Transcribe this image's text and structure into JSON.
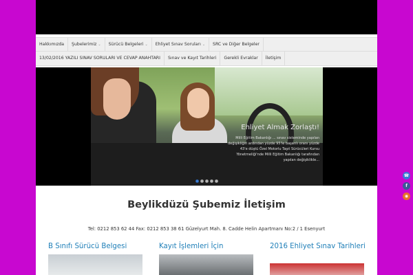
{
  "colors": {
    "background": "#c807d0",
    "link": "#1f7fb8",
    "slider_dot_active": "#3d7fd6"
  },
  "nav": {
    "row1": [
      {
        "label": "Hakkımızda",
        "dropdown": false
      },
      {
        "label": "Şubelerimiz",
        "dropdown": true
      },
      {
        "label": "Sürücü Belgeleri",
        "dropdown": true
      },
      {
        "label": "Ehliyet Sınav Soruları",
        "dropdown": true
      },
      {
        "label": "SRC ve Diğer Belgeler",
        "dropdown": false
      }
    ],
    "row2": [
      {
        "label": "13/02/2016 YAZILI SINAV SORULARI VE CEVAP ANAHTARI",
        "dropdown": false
      },
      {
        "label": "Sınav ve Kayıt Tarihleri",
        "dropdown": false
      },
      {
        "label": "Gerekli Evraklar",
        "dropdown": false
      },
      {
        "label": "İletişim",
        "dropdown": false
      }
    ],
    "chevron": "⌄"
  },
  "slider": {
    "title": "Ehliyet Almak Zorlaştı!",
    "text": "Milli Eğitim Bakanlığı ... sınav sisteminde yapılan değişikliğin ardından yüzde 95'le başarılı oranı yüzde 43'e düştü Özel Motorlu Taşıt Sürücüleri Kursu Yönetmeliği'nde Milli Eğitim Bakanlığı tarafından yapılan değişiklikle...",
    "dots": 5,
    "active_dot": 0
  },
  "main": {
    "heading": "Beylikdüzü Şubemiz İletişim",
    "contact": "Tel: 0212 853 62 44 Fax: 0212 853 38 61 Güzelyurt Mah. 8. Cadde Helin Apartmanı No:2 / 1 Esenyurt"
  },
  "columns": [
    {
      "title": "B Sınıfı Sürücü Belgesi"
    },
    {
      "title": "Kayıt İşlemleri İçin"
    },
    {
      "title": "2016 Ehliyet Sınav Tarihleri"
    }
  ],
  "social": [
    {
      "icon": "phone-icon",
      "glyph": "☎",
      "color": "#3a7bd5"
    },
    {
      "icon": "facebook-icon",
      "glyph": "f",
      "color": "#3b5998"
    },
    {
      "icon": "rss-icon",
      "glyph": "◉",
      "color": "#e8702a"
    }
  ]
}
